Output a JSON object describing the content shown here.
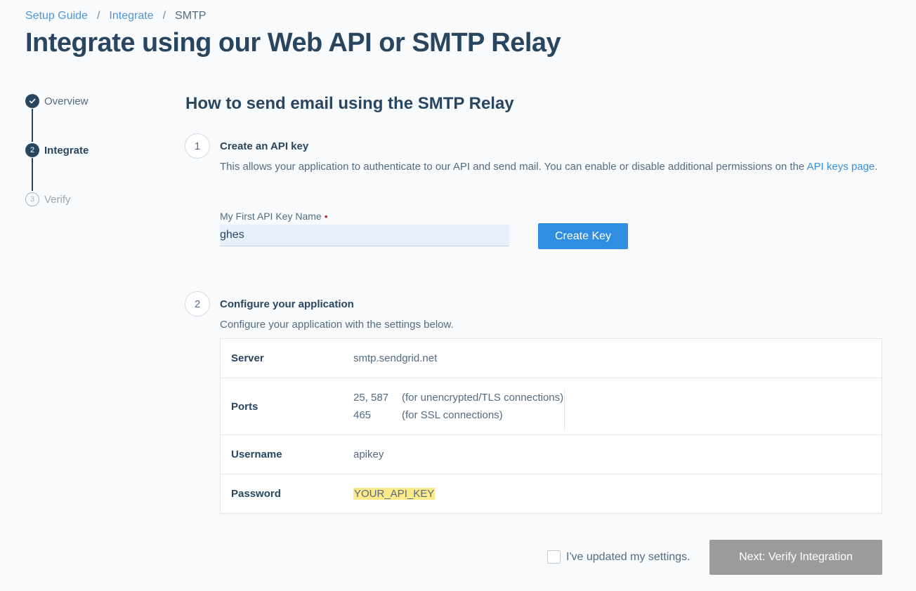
{
  "breadcrumb": {
    "items": [
      {
        "label": "Setup Guide"
      },
      {
        "label": "Integrate"
      },
      {
        "label": "SMTP"
      }
    ],
    "separator": "/"
  },
  "page_title": "Integrate using our Web API or SMTP Relay",
  "stepper": {
    "steps": [
      {
        "number": "1",
        "label": "Overview",
        "state": "done"
      },
      {
        "number": "2",
        "label": "Integrate",
        "state": "active"
      },
      {
        "number": "3",
        "label": "Verify",
        "state": "todo"
      }
    ]
  },
  "main": {
    "title": "How to send email using the SMTP Relay",
    "step1": {
      "number": "1",
      "heading": "Create an API key",
      "description": "This allows your application to authenticate to our API and send mail. You can enable or disable additional permissions on the",
      "link_text": "API keys page",
      "after_link": ".",
      "field_label": "My First API Key Name",
      "required_mark": "•",
      "field_value": "ghes",
      "button_label": "Create Key"
    },
    "step2": {
      "number": "2",
      "heading": "Configure your application",
      "description": "Configure your application with the settings below.",
      "settings": {
        "server": {
          "label": "Server",
          "value": "smtp.sendgrid.net"
        },
        "ports": {
          "label": "Ports",
          "rows": [
            {
              "ports": "25, 587",
              "note": "(for unencrypted/TLS connections)"
            },
            {
              "ports": "465",
              "note": "(for SSL connections)"
            }
          ]
        },
        "username": {
          "label": "Username",
          "value": "apikey"
        },
        "password": {
          "label": "Password",
          "value": "YOUR_API_KEY"
        }
      }
    }
  },
  "footer": {
    "checkbox_label": "I've updated my settings.",
    "checkbox_checked": false,
    "next_button": "Next: Verify Integration"
  },
  "colors": {
    "primary_button": "#2f8ee1",
    "disabled_button": "#9b9b9b",
    "heading": "#294661",
    "link": "#3a8fdc",
    "highlight": "#fce98a"
  }
}
